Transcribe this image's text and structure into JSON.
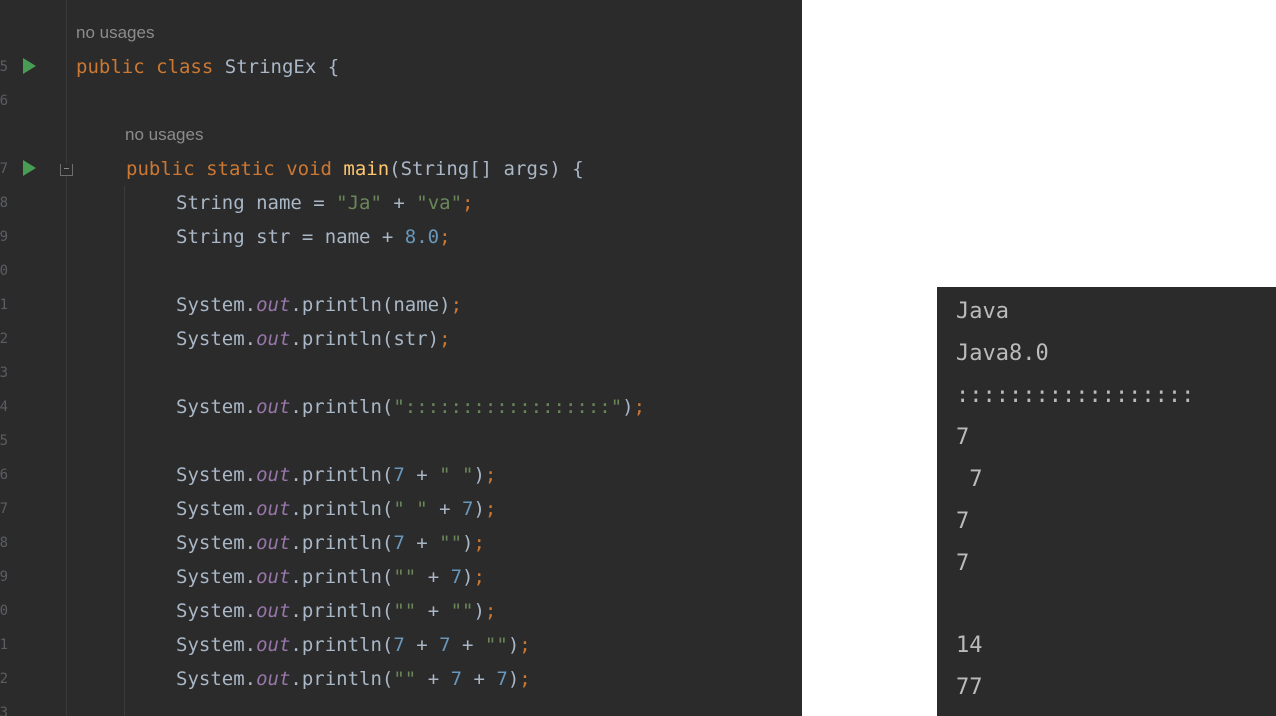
{
  "editor": {
    "line_numbers": [
      "5",
      "6",
      "7",
      "8",
      "9",
      "0",
      "1",
      "2",
      "3",
      "4",
      "5",
      "6",
      "7",
      "8",
      "9",
      "0",
      "1",
      "2",
      "3"
    ],
    "class_hint": "no usages",
    "method_hint": "no usages",
    "code": {
      "class_decl": {
        "kw1": "public",
        "kw2": "class",
        "name": "StringEx",
        "brace": "{"
      },
      "main_decl": {
        "kw1": "public",
        "kw2": "static",
        "kw3": "void",
        "method": "main",
        "params": "(String[] args) {"
      },
      "l8": {
        "a": "String name = ",
        "s1": "\"Ja\"",
        "b": " + ",
        "s2": "\"va\"",
        "semi": ";"
      },
      "l9": {
        "a": "String str = name + ",
        "n": "8.0",
        "semi": ";"
      },
      "l11": {
        "a": "System.",
        "out": "out",
        "b": ".println(name)",
        "semi": ";"
      },
      "l12": {
        "a": "System.",
        "out": "out",
        "b": ".println(str)",
        "semi": ";"
      },
      "l14": {
        "a": "System.",
        "out": "out",
        "b": ".println(",
        "s": "\"::::::::::::::::::\"",
        "c": ")",
        "semi": ";"
      },
      "l16": {
        "a": "System.",
        "out": "out",
        "b": ".println(",
        "n1": "7",
        "op": " + ",
        "s1": "\" \"",
        "c": ")",
        "semi": ";"
      },
      "l17": {
        "a": "System.",
        "out": "out",
        "b": ".println(",
        "s1": "\" \"",
        "op": " + ",
        "n1": "7",
        "c": ")",
        "semi": ";"
      },
      "l18": {
        "a": "System.",
        "out": "out",
        "b": ".println(",
        "n1": "7",
        "op": " + ",
        "s1": "\"\"",
        "c": ")",
        "semi": ";"
      },
      "l19": {
        "a": "System.",
        "out": "out",
        "b": ".println(",
        "s1": "\"\"",
        "op": " + ",
        "n1": "7",
        "c": ")",
        "semi": ";"
      },
      "l20": {
        "a": "System.",
        "out": "out",
        "b": ".println(",
        "s1": "\"\"",
        "op": " + ",
        "s2": "\"\"",
        "c": ")",
        "semi": ";"
      },
      "l21": {
        "a": "System.",
        "out": "out",
        "b": ".println(",
        "n1": "7",
        "op1": " + ",
        "n2": "7",
        "op2": " + ",
        "s1": "\"\"",
        "c": ")",
        "semi": ";"
      },
      "l22": {
        "a": "System.",
        "out": "out",
        "b": ".println(",
        "s1": "\"\"",
        "op1": " + ",
        "n1": "7",
        "op2": " + ",
        "n2": "7",
        "c": ")",
        "semi": ";"
      }
    }
  },
  "console": {
    "lines": [
      "Java",
      "Java8.0",
      "::::::::::::::::::",
      "7",
      " 7",
      "7",
      "7",
      "",
      "14",
      "77"
    ]
  },
  "colors": {
    "editor_bg": "#2b2b2b",
    "keyword": "#cc7832",
    "string": "#6a8759",
    "number": "#6897bb",
    "method_decl": "#ffc66d",
    "static_field": "#9876aa",
    "default_text": "#a9b7c6",
    "run_icon": "#499c54"
  }
}
